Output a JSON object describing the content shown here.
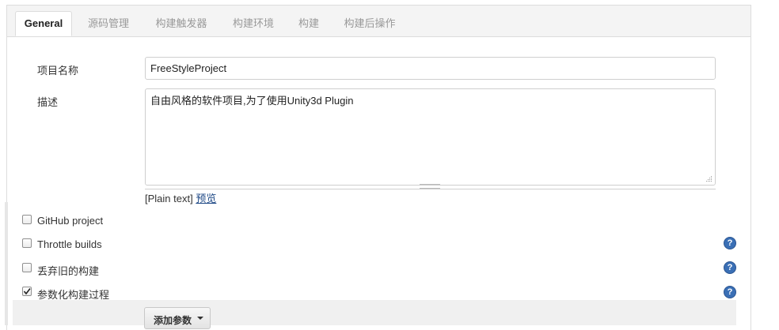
{
  "tabs": [
    {
      "label": "General",
      "active": true
    },
    {
      "label": "源码管理",
      "active": false
    },
    {
      "label": "构建触发器",
      "active": false
    },
    {
      "label": "构建环境",
      "active": false
    },
    {
      "label": "构建",
      "active": false
    },
    {
      "label": "构建后操作",
      "active": false
    }
  ],
  "form": {
    "project_name_label": "项目名称",
    "project_name_value": "FreeStyleProject",
    "description_label": "描述",
    "description_value": "自由风格的软件项目,为了使用Unity3d Plugin",
    "plain_text": "[Plain text]",
    "preview_link": "预览"
  },
  "options": [
    {
      "label": "GitHub project",
      "checked": false,
      "help": false
    },
    {
      "label": "Throttle builds",
      "checked": false,
      "help": true
    },
    {
      "label": "丢弃旧的构建",
      "checked": false,
      "help": true
    },
    {
      "label": "参数化构建过程",
      "checked": true,
      "help": true
    }
  ],
  "help_glyph": "?",
  "add_param_button": "添加参数",
  "colors": {
    "link": "#204a87",
    "help_icon": "#3a6fb5",
    "active_tab_text": "#222222",
    "inactive_tab_text": "#999999"
  }
}
